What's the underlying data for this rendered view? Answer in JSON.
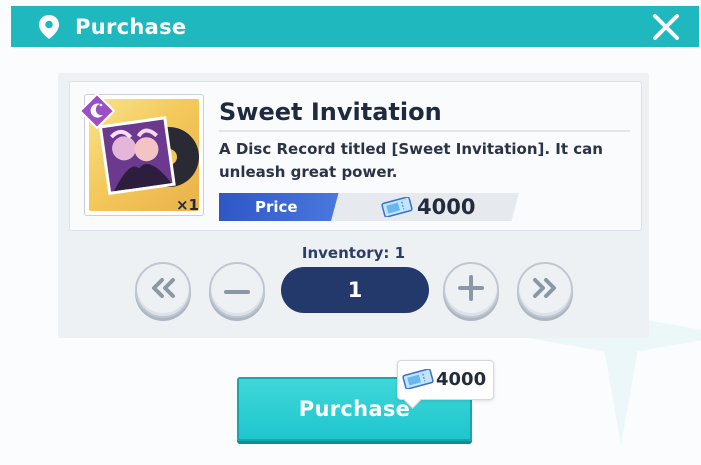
{
  "window": {
    "title": "Purchase",
    "icons": {
      "location": "map-pin-icon",
      "close": "close-x-icon"
    }
  },
  "item": {
    "name": "Sweet Invitation",
    "description": "A Disc Record titled [Sweet Invitation]. It can unleash great power.",
    "quantity_badge": "×1",
    "category_icon": "moon-badge-icon",
    "art": "disc-record-art"
  },
  "price": {
    "label": "Price",
    "value": "4000",
    "currency_icon": "ticket-icon"
  },
  "inventory": {
    "text": "Inventory: 1"
  },
  "quantity": {
    "value": "1",
    "controls": {
      "min": "double-chevron-left-icon",
      "decrement": "minus-icon",
      "increment": "plus-icon",
      "max": "double-chevron-right-icon"
    }
  },
  "purchase": {
    "button_label": "Purchase",
    "cost": "4000"
  },
  "colors": {
    "title_bar": "#1fb8bf",
    "price_tag": "#2f57c4",
    "quantity_field": "#23386b",
    "purchase_button": "#1ec6cd",
    "text_dark": "#1f2a40",
    "badge_purple": "#9b4fc7"
  }
}
